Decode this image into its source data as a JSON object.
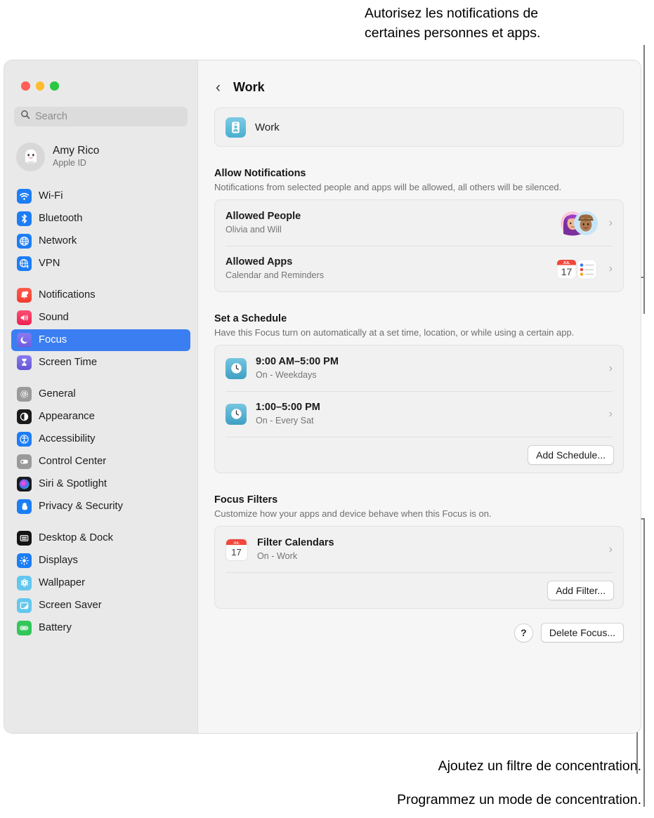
{
  "callouts": {
    "top": "Autorisez les notifications de\ncertaines personnes et apps.",
    "filter": "Ajoutez un filtre de concentration.",
    "schedule": "Programmez un mode de concentration."
  },
  "sidebar": {
    "search": {
      "placeholder": "Search",
      "value": ""
    },
    "account": {
      "name": "Amy Rico",
      "subtitle": "Apple ID"
    },
    "groups": [
      {
        "items": [
          {
            "label": "Wi-Fi",
            "icon": "wifi-icon",
            "selected": false
          },
          {
            "label": "Bluetooth",
            "icon": "bluetooth-icon",
            "selected": false
          },
          {
            "label": "Network",
            "icon": "network-icon",
            "selected": false
          },
          {
            "label": "VPN",
            "icon": "vpn-icon",
            "selected": false
          }
        ]
      },
      {
        "items": [
          {
            "label": "Notifications",
            "icon": "notifications-icon",
            "selected": false
          },
          {
            "label": "Sound",
            "icon": "sound-icon",
            "selected": false
          },
          {
            "label": "Focus",
            "icon": "focus-icon",
            "selected": true
          },
          {
            "label": "Screen Time",
            "icon": "screen-time-icon",
            "selected": false
          }
        ]
      },
      {
        "items": [
          {
            "label": "General",
            "icon": "general-icon",
            "selected": false
          },
          {
            "label": "Appearance",
            "icon": "appearance-icon",
            "selected": false
          },
          {
            "label": "Accessibility",
            "icon": "accessibility-icon",
            "selected": false
          },
          {
            "label": "Control Center",
            "icon": "control-center-icon",
            "selected": false
          },
          {
            "label": "Siri & Spotlight",
            "icon": "siri-icon",
            "selected": false
          },
          {
            "label": "Privacy & Security",
            "icon": "privacy-icon",
            "selected": false
          }
        ]
      },
      {
        "items": [
          {
            "label": "Desktop & Dock",
            "icon": "desktop-dock-icon",
            "selected": false
          },
          {
            "label": "Displays",
            "icon": "displays-icon",
            "selected": false
          },
          {
            "label": "Wallpaper",
            "icon": "wallpaper-icon",
            "selected": false
          },
          {
            "label": "Screen Saver",
            "icon": "screen-saver-icon",
            "selected": false
          },
          {
            "label": "Battery",
            "icon": "battery-icon",
            "selected": false
          }
        ]
      }
    ]
  },
  "main": {
    "title": "Work",
    "focus_card": {
      "name": "Work",
      "icon": "work-badge-icon"
    },
    "allow_notifications": {
      "title": "Allow Notifications",
      "description": "Notifications from selected people and apps will be allowed, all others will be silenced.",
      "rows": [
        {
          "title": "Allowed People",
          "subtitle": "Olivia and Will",
          "accessory": "memoji-pair"
        },
        {
          "title": "Allowed Apps",
          "subtitle": "Calendar and Reminders",
          "accessory": "app-pair"
        }
      ]
    },
    "schedule": {
      "title": "Set a Schedule",
      "description": "Have this Focus turn on automatically at a set time, location, or while using a certain app.",
      "rows": [
        {
          "title": "9:00 AM–5:00 PM",
          "subtitle": "On - Weekdays",
          "icon": "clock-icon"
        },
        {
          "title": "1:00–5:00 PM",
          "subtitle": "On - Every Sat",
          "icon": "clock-icon"
        }
      ],
      "add_button": "Add Schedule..."
    },
    "filters": {
      "title": "Focus Filters",
      "description": "Customize how your apps and device behave when this Focus is on.",
      "rows": [
        {
          "title": "Filter Calendars",
          "subtitle": "On - Work",
          "icon": "calendar-icon"
        }
      ],
      "add_button": "Add Filter..."
    },
    "bottom": {
      "help_label": "?",
      "delete_label": "Delete Focus..."
    }
  },
  "colors": {
    "accent_selected": "#3b7ef2",
    "window_bg": "#f6f6f6",
    "sidebar_bg": "#e9e9e9"
  }
}
